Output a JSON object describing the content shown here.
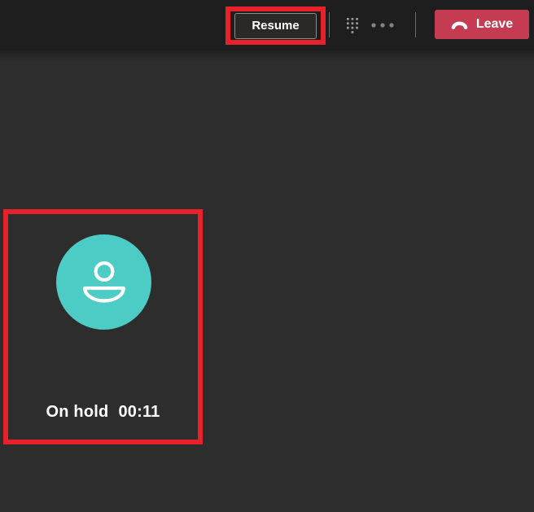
{
  "header": {
    "resume_button": {
      "label": "Resume"
    },
    "dialpad_icon": "dialpad-icon",
    "more_options_icon": "more-options-icon",
    "leave_button": {
      "label": "Leave",
      "icon": "hang-up-phone-icon"
    }
  },
  "stage": {
    "participant": {
      "avatar_icon": "person-icon",
      "status_label": "On hold",
      "timer": "00:11"
    }
  },
  "annotations": {
    "highlighted_elements": [
      "resume-button",
      "participant-tile"
    ]
  },
  "colors": {
    "bar-bg": "#1f1e1e",
    "stage-bg": "#2e2d2d",
    "annotation-red": "#e8222a",
    "avatar-teal": "#4dccc5",
    "leave-red": "#c43b52",
    "icon-gray": "#9d9b99",
    "text-white": "#ffffff"
  }
}
